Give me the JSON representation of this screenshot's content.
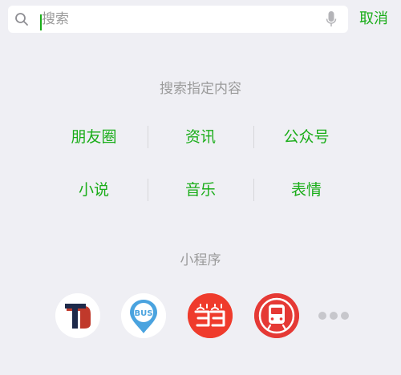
{
  "search": {
    "placeholder": "搜索",
    "cancel_label": "取消"
  },
  "specified": {
    "title": "搜索指定内容",
    "categories": [
      {
        "label": "朋友圈"
      },
      {
        "label": "资讯"
      },
      {
        "label": "公众号"
      },
      {
        "label": "小说"
      },
      {
        "label": "音乐"
      },
      {
        "label": "表情"
      }
    ]
  },
  "mini_programs": {
    "title": "小程序",
    "apps": [
      {
        "icon": "t-logo-icon"
      },
      {
        "icon": "bus-icon",
        "badge_text": "BUS"
      },
      {
        "icon": "dangdang-icon"
      },
      {
        "icon": "metro-train-icon"
      }
    ]
  },
  "colors": {
    "accent_green": "#1aad19",
    "background": "#efeff4",
    "dangdang_red": "#ef3b2c",
    "metro_red": "#e53935"
  }
}
